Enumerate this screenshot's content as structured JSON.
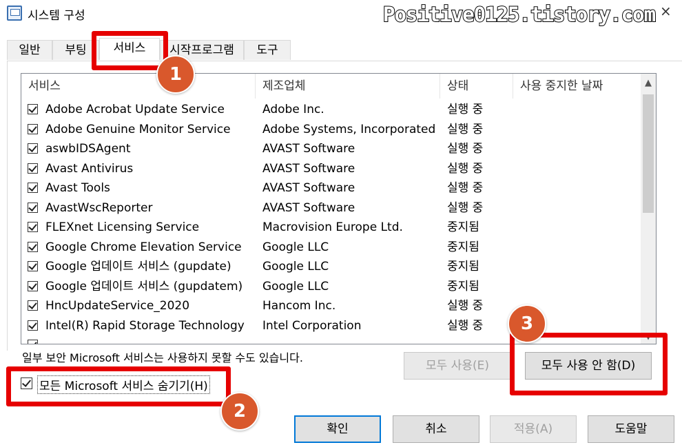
{
  "window": {
    "title": "시스템 구성",
    "watermark": "Positive0125.tistory.com",
    "close": "×"
  },
  "tabs": [
    {
      "label": "일반"
    },
    {
      "label": "부팅"
    },
    {
      "label": "서비스"
    },
    {
      "label": "시작프로그램"
    },
    {
      "label": "도구"
    }
  ],
  "active_tab": "서비스",
  "columns": {
    "service": "서비스",
    "maker": "제조업체",
    "status": "상태",
    "disabled_date": "사용 중지한 날짜"
  },
  "rows": [
    {
      "name": "Adobe Acrobat Update Service",
      "maker": "Adobe Inc.",
      "status": "실행 중",
      "checked": true
    },
    {
      "name": "Adobe Genuine Monitor Service",
      "maker": "Adobe Systems, Incorporated",
      "status": "실행 중",
      "checked": true
    },
    {
      "name": "aswbIDSAgent",
      "maker": "AVAST Software",
      "status": "실행 중",
      "checked": true
    },
    {
      "name": "Avast Antivirus",
      "maker": "AVAST Software",
      "status": "실행 중",
      "checked": true
    },
    {
      "name": "Avast Tools",
      "maker": "AVAST Software",
      "status": "실행 중",
      "checked": true
    },
    {
      "name": "AvastWscReporter",
      "maker": "AVAST Software",
      "status": "실행 중",
      "checked": true
    },
    {
      "name": "FLEXnet Licensing Service",
      "maker": "Macrovision Europe Ltd.",
      "status": "중지됨",
      "checked": true
    },
    {
      "name": "Google Chrome Elevation Service",
      "maker": "Google LLC",
      "status": "중지됨",
      "checked": true
    },
    {
      "name": "Google 업데이트 서비스 (gupdate)",
      "maker": "Google LLC",
      "status": "중지됨",
      "checked": true
    },
    {
      "name": "Google 업데이트 서비스 (gupdatem)",
      "maker": "Google LLC",
      "status": "중지됨",
      "checked": true
    },
    {
      "name": "HncUpdateService_2020",
      "maker": "Hancom Inc.",
      "status": "실행 중",
      "checked": true
    },
    {
      "name": "Intel(R) Rapid Storage Technology",
      "maker": "Intel Corporation",
      "status": "실행 중",
      "checked": true
    }
  ],
  "note": "일부 보안 Microsoft 서비스는 사용하지 못할 수도 있습니다.",
  "buttons": {
    "enable_all": "모두 사용(E)",
    "disable_all": "모두 사용 안 함(D)",
    "hide_ms": "모든 Microsoft 서비스 숨기기(H)",
    "ok": "확인",
    "cancel": "취소",
    "apply": "적용(A)",
    "help": "도움말"
  },
  "annotations": {
    "badge1": "1",
    "badge2": "2",
    "badge3": "3"
  },
  "colors": {
    "highlight": "#e60000",
    "badge": "#d9582c",
    "default_button_border": "#0078d7"
  }
}
